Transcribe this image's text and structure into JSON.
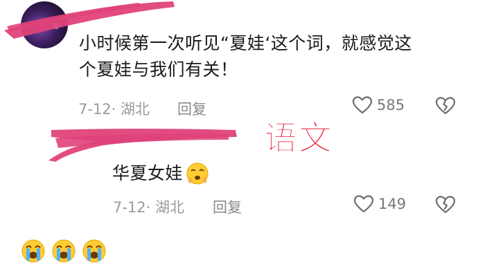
{
  "comment": {
    "text_line1": "小时候第一次听见“夏娃‘这个词，就感觉这",
    "text_line2": "个夏娃与我们有关！",
    "date_location": "7-12· 湖北",
    "reply_label": "回复",
    "like_count": "585"
  },
  "watermark": "语文",
  "reply": {
    "text": "华夏女娃",
    "date_location": "7-12· 湖北",
    "reply_label": "回复",
    "like_count": "149"
  },
  "icons": {
    "like": "heart-outline-icon",
    "dislike": "broken-heart-icon",
    "emoji": "crying-face-emoji"
  },
  "colors": {
    "redaction": "#e0427a",
    "watermark": "#e5102a",
    "meta_text": "#9a9a9a"
  }
}
